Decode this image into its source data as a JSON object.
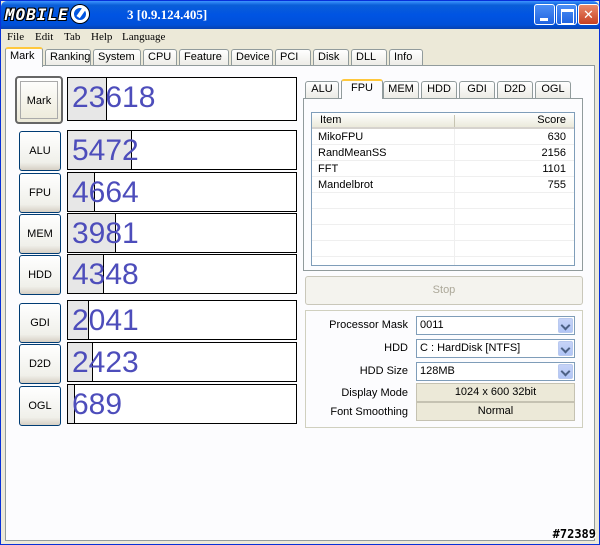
{
  "title": {
    "logo": "MOBILE",
    "version": "3 [0.9.124.405]"
  },
  "menu": [
    "File",
    "Edit",
    "Tab",
    "Help",
    "Language"
  ],
  "tabs": [
    "Mark",
    "Ranking",
    "System",
    "CPU",
    "Feature",
    "Device",
    "PCI",
    "Disk",
    "DLL",
    "Info"
  ],
  "active_tab": "Mark",
  "scores": {
    "mark": {
      "label": "Mark",
      "value": "23618",
      "fill": 0.17
    },
    "alu": {
      "label": "ALU",
      "value": "5472",
      "fill": 0.28
    },
    "fpu": {
      "label": "FPU",
      "value": "4664",
      "fill": 0.12
    },
    "mem": {
      "label": "MEM",
      "value": "3981",
      "fill": 0.21
    },
    "hdd": {
      "label": "HDD",
      "value": "4348",
      "fill": 0.16
    },
    "gdi": {
      "label": "GDI",
      "value": "2041",
      "fill": 0.09
    },
    "d2d": {
      "label": "D2D",
      "value": "2423",
      "fill": 0.11
    },
    "ogl": {
      "label": "OGL",
      "value": "689",
      "fill": 0.03
    }
  },
  "subtabs": [
    "ALU",
    "FPU",
    "MEM",
    "HDD",
    "GDI",
    "D2D",
    "OGL"
  ],
  "active_subtab": "FPU",
  "list": {
    "col_item": "Item",
    "col_score": "Score",
    "rows": [
      {
        "item": "MikoFPU",
        "score": "630"
      },
      {
        "item": "RandMeanSS",
        "score": "2156"
      },
      {
        "item": "FFT",
        "score": "1101"
      },
      {
        "item": "Mandelbrot",
        "score": "755"
      }
    ]
  },
  "stop_label": "Stop",
  "settings": {
    "processor_mask_label": "Processor Mask",
    "processor_mask_value": "0011",
    "hdd_label": "HDD",
    "hdd_value": "C : HardDisk [NTFS]",
    "hdd_size_label": "HDD Size",
    "hdd_size_value": "128MB",
    "display_mode_label": "Display Mode",
    "display_mode_value": "1024 x 600 32bit",
    "font_smoothing_label": "Font Smoothing",
    "font_smoothing_value": "Normal"
  },
  "watermark": "#72389"
}
